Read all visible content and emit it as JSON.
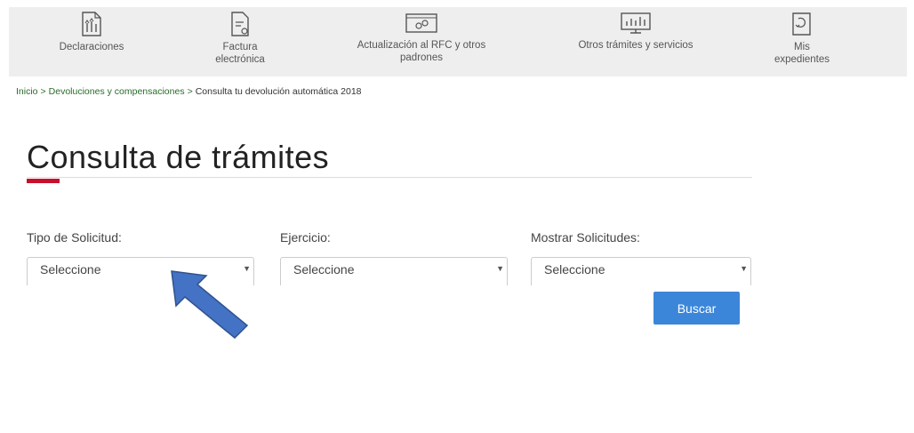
{
  "nav": {
    "items": [
      {
        "label": "Declaraciones",
        "icon": "declaraciones-icon"
      },
      {
        "label": "Factura electrónica",
        "icon": "factura-icon"
      },
      {
        "label": "Actualización al RFC y otros padrones",
        "icon": "rfc-update-icon"
      },
      {
        "label": "Otros trámites y servicios",
        "icon": "otros-tramites-icon"
      },
      {
        "label": "Mis expedientes",
        "icon": "expedientes-icon"
      }
    ]
  },
  "breadcrumb": {
    "items": [
      "Inicio",
      "Devoluciones y compensaciones",
      "Consulta tu devolución automática 2018"
    ],
    "separator": ">"
  },
  "page": {
    "title": "Consulta de trámites"
  },
  "form": {
    "tipo_label": "Tipo de Solicitud:",
    "tipo_value": "Seleccione",
    "ejercicio_label": "Ejercicio:",
    "ejercicio_value": "Seleccione",
    "mostrar_label": "Mostrar Solicitudes:",
    "mostrar_value": "Seleccione",
    "buscar_label": "Buscar"
  },
  "colors": {
    "accent": "#c8102e",
    "button": "#3b86d9",
    "nav_bg": "#eeeeee",
    "annotation_arrow": "#4472c4"
  }
}
